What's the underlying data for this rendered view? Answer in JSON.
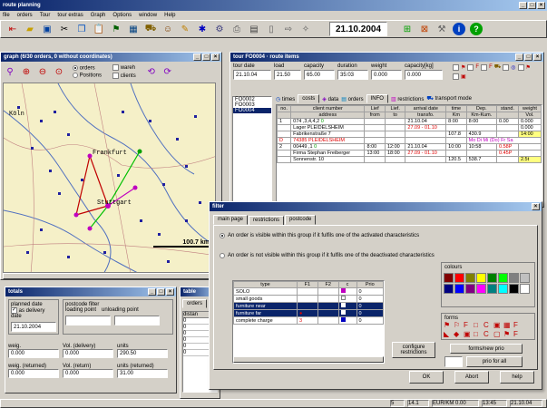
{
  "app": {
    "title": "route planning",
    "menu": [
      "file",
      "orders",
      "Tour",
      "tour extras",
      "Graph",
      "Options",
      "window",
      "Help"
    ],
    "date_field": "21.10.2004"
  },
  "graph_window": {
    "title": "graph (6/30 orders, 0 without coordinates)",
    "radio_orders": "orders",
    "radio_positions": "Positions",
    "radio_wareh": "wareh",
    "radio_clients": "clients",
    "cities": [
      "Köln",
      "Frankfurt",
      "Stuttgart"
    ],
    "scale_label": "100.7 km"
  },
  "tour_window": {
    "title": "tour FO0004 · route items",
    "headers": [
      "tour date",
      "load",
      "capacity",
      "duration",
      "weight",
      "capacity[kg]"
    ],
    "values": [
      "21.10.04",
      "21.50",
      "65.00",
      "35:03",
      "0.000",
      "0.000"
    ],
    "tour_ids": [
      "FO0002",
      "FO0003",
      "FO0004"
    ],
    "tabs": [
      "times",
      "costs",
      "data",
      "orders",
      "INFO",
      "restrictions",
      "transport mode"
    ],
    "table_headers": [
      "no.",
      "client number",
      "Lief",
      "Lief.",
      "arrival date",
      "time",
      "Dep.",
      "stand.",
      "weight"
    ],
    "subheaders": [
      "",
      "address",
      "from",
      "to",
      "transfo.",
      "Km",
      "Km-Kum.",
      "Vol."
    ],
    "rows": [
      [
        "1",
        "074",
        ",3,4,4,2",
        "0",
        "",
        "21.10.04",
        "8:00",
        "8:00",
        "0.00",
        "0.000"
      ],
      [
        "",
        "Lager PLEIDELSHEIM",
        "",
        "",
        "",
        "27.09 - 01.10",
        "",
        "",
        "",
        "0.000"
      ],
      [
        "",
        "Fabrikenstraße 7",
        "",
        "",
        "",
        "",
        "107.8",
        "430.9",
        "14:00",
        ""
      ],
      [
        "D",
        "74385 PLEIDELSHEIM",
        "",
        "",
        "",
        "",
        "Mo Di Mi (Do) Fr Sa",
        "",
        "",
        ""
      ],
      [
        "2",
        "00449",
        ",1",
        "0",
        "8:00",
        "12:00",
        "21.10.04",
        "10:00",
        "10:58",
        "0.58P"
      ],
      [
        "",
        "Firma Stephan Freiberger",
        "",
        "",
        "13:00",
        "18:00",
        "27.09 - 01.10",
        "",
        "",
        "0.45P"
      ],
      [
        "",
        "Sonnenstr. 10",
        "",
        "",
        "",
        "",
        "120.5",
        "538.7",
        "2.5t",
        ""
      ]
    ]
  },
  "totals_window": {
    "title": "totals",
    "planned_date_label": "planned date",
    "as_delivery_date": "as delivery date",
    "postcode_filter": "postcode filter",
    "loading_point": "loading point",
    "unloading_point": "unloading point",
    "date_value": "21.10.2004",
    "weig_label": "weig.",
    "vol_delivery_label": "Vol. (delivery)",
    "units_label": "units",
    "weig_value": "0.000",
    "vol_delivery_value": "0.000",
    "units_value": "290.50",
    "weig_returned_label": "weig. (returned)",
    "vol_return_label": "Vol. (return)",
    "units_returned_label": "units (returned)",
    "weig_returned_value": "0.000",
    "vol_return_value": "0.000",
    "units_returned_value": "31.00"
  },
  "table_window": {
    "title": "table",
    "tab": "orders",
    "col": "distan",
    "values": [
      "0",
      "0",
      "0",
      "0",
      "0",
      "0"
    ]
  },
  "filter_dialog": {
    "title": "filter",
    "tabs": [
      "main page",
      "restrictions",
      "postcode"
    ],
    "opt1": "An order is visible within this group if it fulfils one of the activated characteristics",
    "opt2": "An order is not visible within this group if it fulfils one of the deactivated characteristics",
    "col_headers": [
      "type",
      "F1",
      "F2",
      "c",
      "Prio"
    ],
    "rows": [
      {
        "type": "SOLO",
        "f1": "",
        "prio": "0"
      },
      {
        "type": "small goods",
        "f1": "",
        "prio": "0"
      },
      {
        "type": "furniture near",
        "f1": "",
        "prio": "0"
      },
      {
        "type": "furniture far",
        "f1": "",
        "prio": "0"
      },
      {
        "type": "complete charge",
        "f1": "3",
        "prio": "0"
      }
    ],
    "colours_label": "colours",
    "forms_label": "forms",
    "configure_btn": "configure restrictions",
    "forms_prio_btn": "forms/new prio",
    "prio_all_btn": "prio for all",
    "ok": "OK",
    "abort": "Abort",
    "help": "help",
    "swatches": [
      "#800000",
      "#ff0000",
      "#808000",
      "#ffff00",
      "#008000",
      "#00ff00",
      "#808080",
      "#c0c0c0",
      "#000080",
      "#0000ff",
      "#800080",
      "#ff00ff",
      "#008080",
      "#00ffff",
      "#000000",
      "#ffffff"
    ]
  },
  "status": {
    "fields": [
      "5",
      "14.1",
      "EUR/KM 0.00",
      "13:45",
      "21.10.04"
    ]
  }
}
